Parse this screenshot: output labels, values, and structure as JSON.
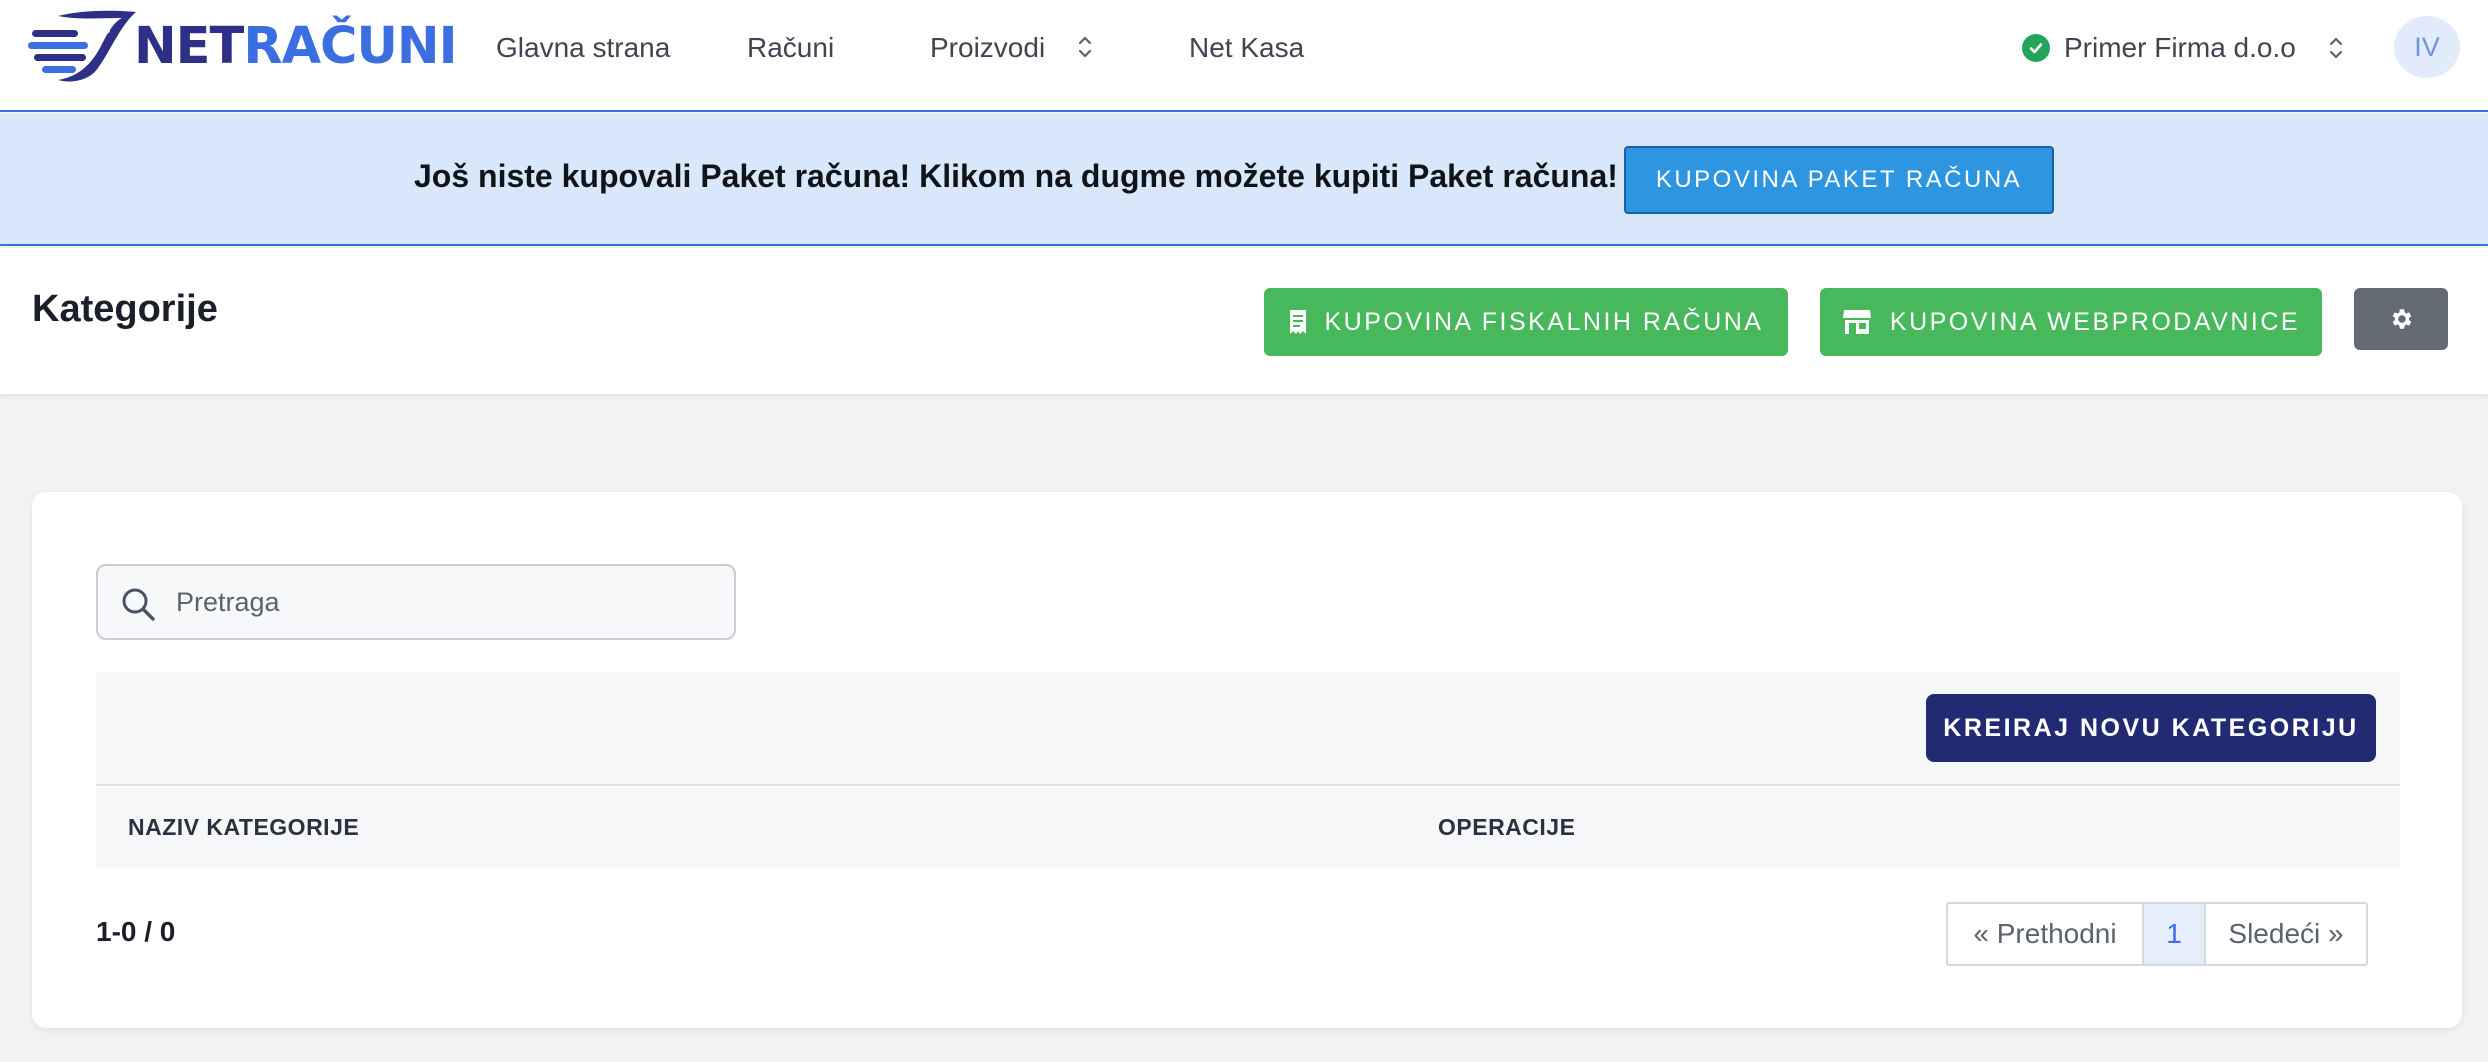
{
  "navbar": {
    "logo": {
      "part1": "NET",
      "part2": "RAČUNI"
    },
    "links": {
      "home": "Glavna strana",
      "invoices": "Računi",
      "products": "Proizvodi",
      "netkasa": "Net Kasa"
    },
    "company": "Primer Firma d.o.o",
    "avatar_initials": "IV",
    "icons": {
      "company_status": "check-circle-icon",
      "dropdown": "chevron-up-down-icon"
    }
  },
  "banner": {
    "text": "Još niste kupovali Paket računa! Klikom na dugme možete kupiti Paket računa!",
    "button": "KUPOVINA PAKET RAČUNA"
  },
  "header": {
    "title": "Kategorije",
    "buy_fiscal": "KUPOVINA FISKALNIH RAČUNA",
    "buy_webshop": "KUPOVINA WEBPRODAVNICE",
    "icons": {
      "fiscal": "receipt-icon",
      "webshop": "store-icon",
      "settings": "gear-icon"
    }
  },
  "card": {
    "search": {
      "placeholder": "Pretraga",
      "value": ""
    },
    "create_button": "KREIRAJ NOVU KATEGORIJU",
    "table": {
      "columns": [
        "NAZIV KATEGORIJE",
        "OPERACIJE"
      ],
      "rows": []
    },
    "count": "1-0 / 0",
    "pagination": {
      "prev": "« Prethodni",
      "current": "1",
      "next": "Sledeći »"
    }
  },
  "colors": {
    "brand_dark": "#2e2f86",
    "brand_blue": "#3b6ee0",
    "banner_bg": "#d9e7fb",
    "banner_button": "#2e96e1",
    "green": "#48b85c",
    "create_button": "#232a74",
    "settings_button": "#656b75"
  }
}
